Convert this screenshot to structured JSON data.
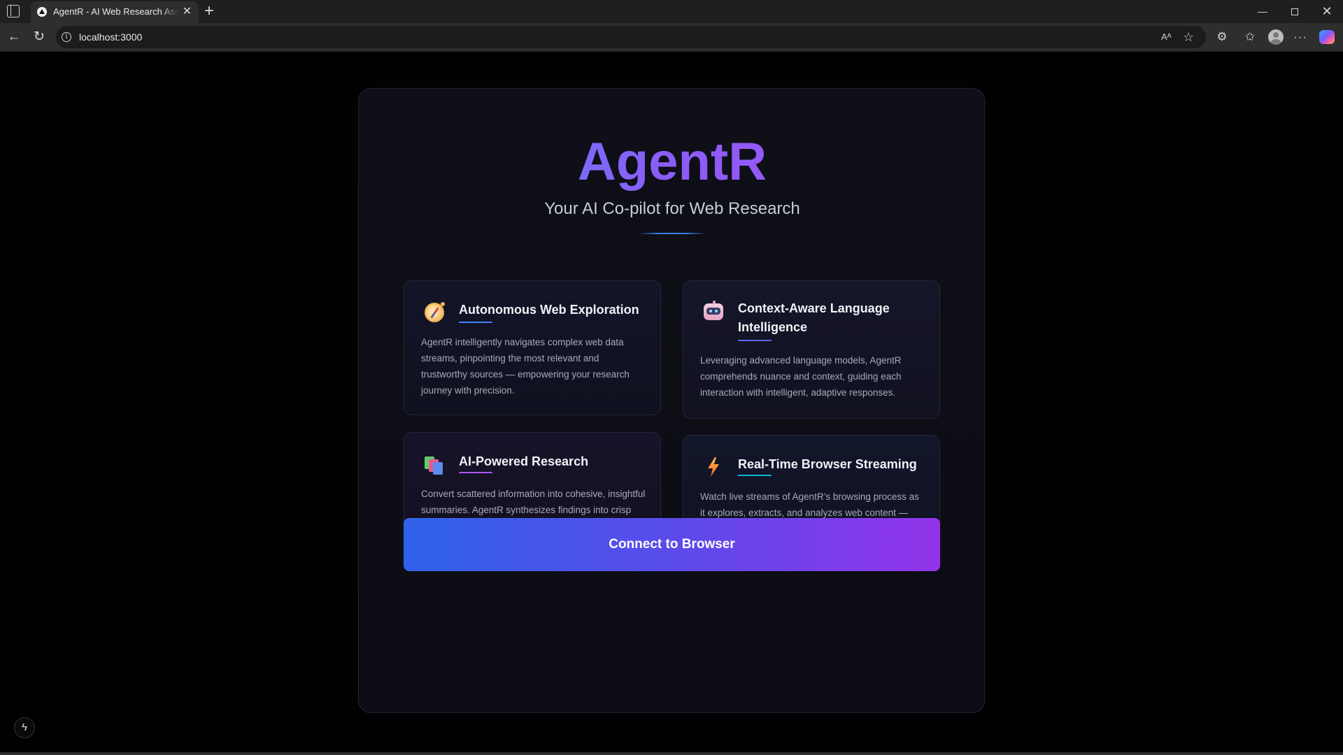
{
  "browser": {
    "tab": {
      "title": "AgentR - AI Web Research Assistant",
      "close_glyph": "✕"
    },
    "new_tab_glyph": "+",
    "address": {
      "url": "localhost:3000"
    },
    "window_controls": {
      "minimize": "—",
      "close": "✕"
    },
    "toolbar_glyphs": {
      "back": "←",
      "reload": "↻",
      "read_aloud": "Aᴬ",
      "favorite": "☆",
      "extensions": "⚙",
      "favorites": "✩",
      "more": "···"
    }
  },
  "hero": {
    "title": "AgentR",
    "tagline": "Your AI Co-pilot for Web Research"
  },
  "features": [
    {
      "icon": "compass-icon",
      "title": "Autonomous Web Exploration",
      "body": "AgentR intelligently navigates complex web data streams, pinpointing the most relevant and trustworthy sources — empowering your research journey with precision.",
      "accent": "#3b82f6"
    },
    {
      "icon": "robot-icon",
      "title": "Context-Aware Language Intelligence",
      "body": "Leveraging advanced language models, AgentR comprehends nuance and context, guiding each interaction with intelligent, adaptive responses.",
      "accent": "#6366f1"
    },
    {
      "icon": "books-icon",
      "title": "AI-Powered Research",
      "body": "Convert scattered information into cohesive, insightful summaries. AgentR synthesizes findings into crisp narratives, accelerating your understanding and writing.",
      "accent": "#a855f7"
    },
    {
      "icon": "lightning-icon",
      "title": "Real-Time Browser Streaming",
      "body": "Watch live streams of AgentR’s browsing process as it explores, extracts, and analyzes web content — keeping you connected to every step in real time.",
      "accent": "#06b6d4"
    }
  ],
  "cta": {
    "label": "Connect to Browser"
  },
  "dev_indicator": {
    "glyph": "ϟ"
  },
  "colors": {
    "brand_gradient_start": "#5b8cff",
    "brand_gradient_end": "#a855f7",
    "button_gradient_start": "#2f63e9",
    "button_gradient_end": "#9333ea",
    "page_background": "#000000",
    "card_background": "#0f0f18"
  }
}
